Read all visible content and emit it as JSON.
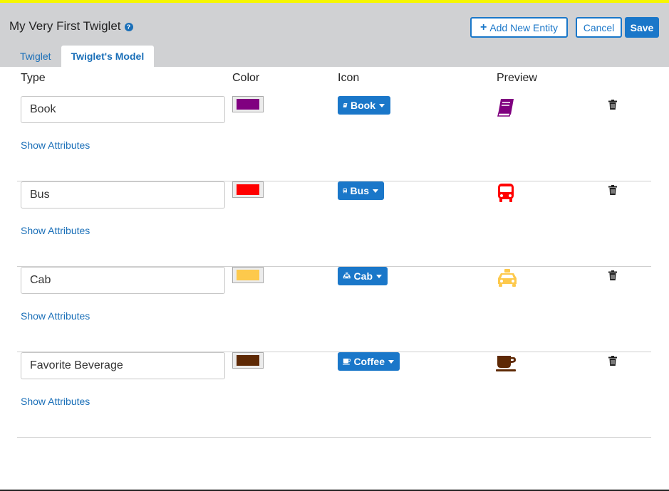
{
  "header": {
    "title": "My Very First Twiglet",
    "add_entity_label": "Add New Entity",
    "cancel_label": "Cancel",
    "save_label": "Save"
  },
  "tabs": [
    {
      "label": "Twiglet",
      "active": false
    },
    {
      "label": "Twiglet's Model",
      "active": true
    }
  ],
  "columns": {
    "type": "Type",
    "color": "Color",
    "icon": "Icon",
    "preview": "Preview"
  },
  "entities": [
    {
      "type": "Book",
      "color": "#800080",
      "icon_label": "Book",
      "icon": "book-icon",
      "show_attributes": "Show Attributes"
    },
    {
      "type": "Bus",
      "color": "#ff0000",
      "icon_label": "Bus",
      "icon": "bus-icon",
      "show_attributes": "Show Attributes"
    },
    {
      "type": "Cab",
      "color": "#fdc94c",
      "icon_label": "Cab",
      "icon": "cab-icon",
      "show_attributes": "Show Attributes"
    },
    {
      "type": "Favorite Beverage",
      "color": "#5e2905",
      "icon_label": "Coffee",
      "icon": "coffee-icon",
      "show_attributes": "Show Attributes"
    }
  ],
  "colors": {
    "accent": "#1a77c9",
    "header_bg": "#d0d1d3",
    "top_bar": "#f6f600"
  }
}
